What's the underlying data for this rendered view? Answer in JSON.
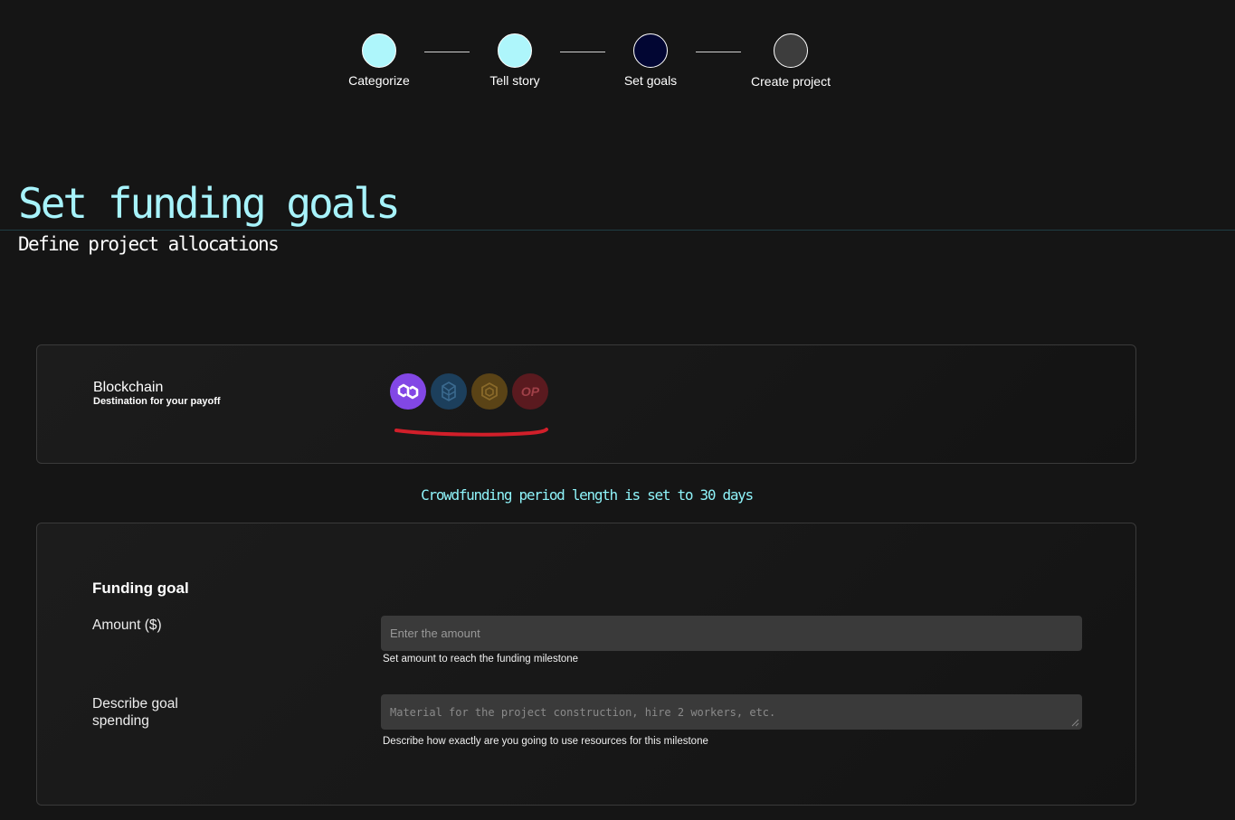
{
  "stepper": {
    "steps": [
      {
        "label": "Categorize",
        "color": "#aef6fb"
      },
      {
        "label": "Tell story",
        "color": "#aef6fb"
      },
      {
        "label": "Set goals",
        "color": "#020633"
      },
      {
        "label": "Create project",
        "color": "#3d3d3d"
      }
    ]
  },
  "header": {
    "title": "Set funding goals",
    "subtitle": "Define project allocations"
  },
  "blockchain": {
    "title": "Blockchain",
    "description": "Destination for your payoff",
    "options": [
      {
        "icon": "polygon-icon",
        "selected": true
      },
      {
        "icon": "fantom-icon",
        "selected": false
      },
      {
        "icon": "bnb-icon",
        "selected": false
      },
      {
        "icon": "optimism-icon",
        "label": "OP",
        "selected": false
      }
    ]
  },
  "period_text": "Crowdfunding period length is set to 30 days",
  "funding": {
    "heading": "Funding goal",
    "amount_label": "Amount ($)",
    "amount_placeholder": "Enter the amount",
    "amount_hint": "Set amount to reach the funding milestone",
    "description_label": "Describe goal spending",
    "description_placeholder": "Material for the project construction, hire 2 workers, etc.",
    "description_hint": "Describe how exactly are you going to use resources for this milestone"
  },
  "colors": {
    "accent": "#a7f3fb",
    "background": "#151515",
    "annotation": "#d11f2a"
  }
}
